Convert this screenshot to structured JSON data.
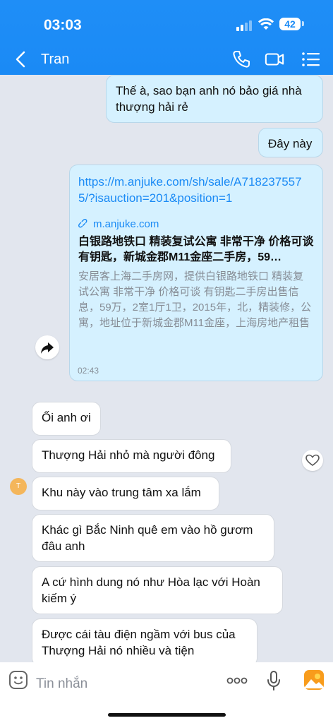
{
  "status_bar": {
    "time": "03:03",
    "battery": "42",
    "icons": [
      "signal-icon",
      "wifi-icon",
      "battery-icon"
    ]
  },
  "header": {
    "contact": "Tran",
    "icons": [
      "back-icon",
      "phone-icon",
      "video-icon",
      "menu-icon"
    ]
  },
  "messages": [
    {
      "side": "out",
      "text": "Thế à, sao bạn anh nó bảo giá nhà thượng hải rẻ"
    },
    {
      "side": "out",
      "text": "Đây này"
    },
    {
      "side": "in",
      "text": "Ối anh ơi"
    },
    {
      "side": "in",
      "text": "Thượng Hải nhỏ mà người đông"
    },
    {
      "side": "in",
      "text": "Khu này vào trung tâm xa lắm"
    },
    {
      "side": "in",
      "text": "Khác gì Bắc Ninh quê em vào hồ gươm đâu anh"
    },
    {
      "side": "in",
      "text": "A cứ hình dung nó như Hòa lạc với Hoàn kiếm ý"
    },
    {
      "side": "in",
      "text": "Được cái tàu điện ngầm với bus của Thượng Hải nó nhiều và tiện"
    }
  ],
  "link_card": {
    "url": "https://m.anjuke.com/sh/sale/A7182375575/?isauction=201&position=1",
    "domain": "m.anjuke.com",
    "title": "白银路地铁口 精装复试公寓 非常干净 价格可谈 有钥匙，新城金郡M11金座二手房，59…",
    "description": "安居客上海二手房网，提供白银路地铁口 精装复试公寓 非常干净 价格可谈 有钥匙二手房出售信息，59万，2室1厅1卫，2015年，北，精装修，公寓，地址位于新城金郡M11金座，上海房地产租售服务平台，安居客全…",
    "time": "02:43"
  },
  "avatar_initial": "T",
  "input": {
    "placeholder": "Tin nhắn",
    "icons": [
      "sticker-icon",
      "more-icon",
      "microphone-icon",
      "image-icon"
    ]
  },
  "colors": {
    "accent": "#1a8af5",
    "outgoing_bubble": "#d5f1ff",
    "background": "#e2e6ee"
  }
}
